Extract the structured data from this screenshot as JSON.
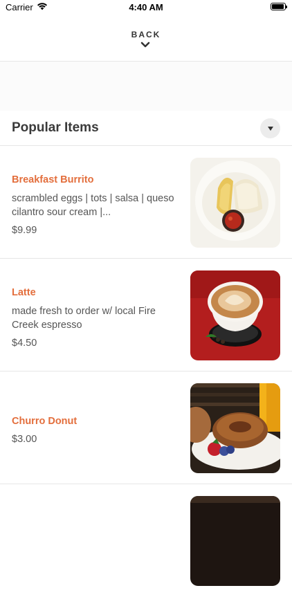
{
  "status_bar": {
    "carrier": "Carrier",
    "time": "4:40 AM",
    "battery_level": 0.95
  },
  "header": {
    "back_label": "BACK"
  },
  "section": {
    "title": "Popular Items"
  },
  "items": [
    {
      "name": "Breakfast Burrito",
      "description": "scrambled eggs | tots | salsa | queso cilantro sour cream |...",
      "price": "$9.99"
    },
    {
      "name": "Latte",
      "description": "made fresh to order w/ local Fire Creek espresso",
      "price": "$4.50"
    },
    {
      "name": "Churro Donut",
      "description": "",
      "price": "$3.00"
    }
  ],
  "colors": {
    "accent": "#e36e3c",
    "divider": "#e6e6e6",
    "text": "#555555"
  },
  "icons": {
    "wifi": "wifi-icon",
    "battery": "battery-icon",
    "back": "chevron-down-icon",
    "dropdown": "caret-down-icon"
  }
}
